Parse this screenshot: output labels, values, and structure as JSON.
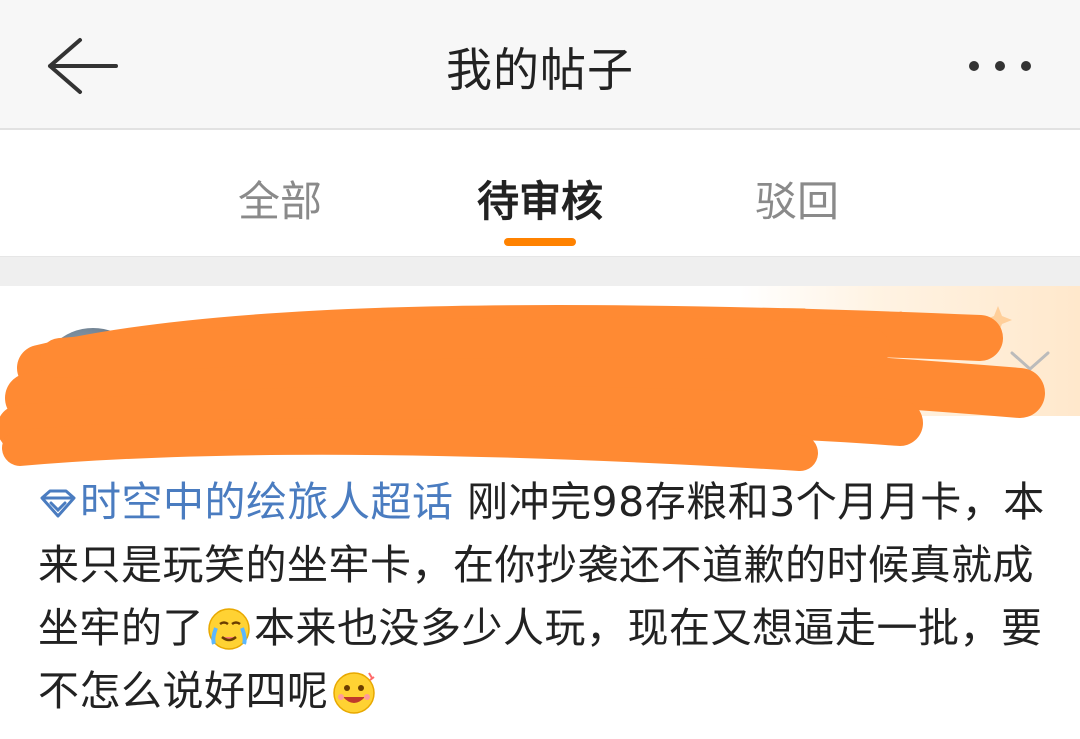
{
  "header": {
    "title": "我的帖子",
    "back_icon": "arrow-left-icon",
    "more_icon": "more-horizontal-icon"
  },
  "tabs": [
    {
      "label": "全部",
      "active": false
    },
    {
      "label": "待审核",
      "active": true
    },
    {
      "label": "驳回",
      "active": false
    }
  ],
  "colors": {
    "accent": "#ff8200",
    "topic_link": "#4a7cc0",
    "redaction": "#ff8a33"
  },
  "post": {
    "topic": "时空中的绘旅人超话",
    "text_1": "刚冲完98存粮和3个月月卡，本来只是玩笑的坐牢卡，在你抄袭还不道歉的时候真就成坐牢的了",
    "text_2": "本来也没多少人玩，现在又想逼走一批，要不怎么说好四呢",
    "emoji_1": "crying-face-emoji",
    "emoji_2": "laughing-face-emoji",
    "badge": "超话",
    "expand_icon": "chevron-down-icon"
  }
}
